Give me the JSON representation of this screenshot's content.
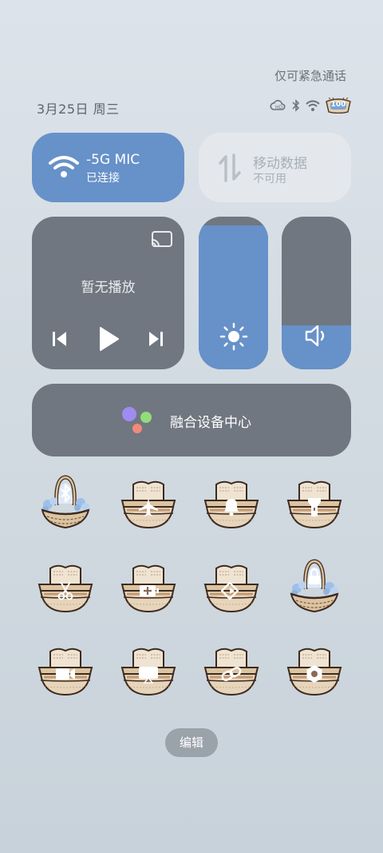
{
  "status_bar": {
    "emergency_text": "仅可紧急通话",
    "date": "3月25日 周三",
    "battery": "100",
    "icons": [
      "cloud-data-icon",
      "bluetooth-icon",
      "wifi-icon",
      "battery-icon"
    ]
  },
  "wifi_tile": {
    "name": "-5G MIC",
    "status": "已连接",
    "icon": "wifi-icon",
    "accent": "#6791c9"
  },
  "mobile_tile": {
    "title": "移动数据",
    "status": "不可用",
    "icon": "data-arrows-icon"
  },
  "media": {
    "title": "暂无播放",
    "icons": [
      "cast-icon",
      "previous-icon",
      "play-icon",
      "next-icon"
    ]
  },
  "brightness": {
    "level": 0.94,
    "icon": "sun-icon"
  },
  "volume": {
    "level": 0.29,
    "icon": "speaker-icon"
  },
  "device_hub": {
    "label": "融合设备中心",
    "icon": "hub-dots-icon"
  },
  "toggles": [
    {
      "name": "bluetooth",
      "icon": "bluetooth-icon",
      "active": true
    },
    {
      "name": "airplane",
      "icon": "airplane-icon",
      "active": false
    },
    {
      "name": "sound",
      "icon": "bell-icon",
      "active": false
    },
    {
      "name": "flashlight",
      "icon": "flashlight-icon",
      "active": false
    },
    {
      "name": "screenshot",
      "icon": "scissors-icon",
      "active": false
    },
    {
      "name": "battery-saver",
      "icon": "battery-plus-icon",
      "active": false
    },
    {
      "name": "rotation-lock",
      "icon": "rotate-icon",
      "active": false
    },
    {
      "name": "lock",
      "icon": "lock-icon",
      "active": true
    },
    {
      "name": "screen-record",
      "icon": "video-camera-icon",
      "active": false
    },
    {
      "name": "cast",
      "icon": "screen-cast-icon",
      "active": false
    },
    {
      "name": "connect",
      "icon": "link-icon",
      "active": false
    },
    {
      "name": "settings",
      "icon": "gear-icon",
      "active": false
    }
  ],
  "edit_label": "编辑"
}
